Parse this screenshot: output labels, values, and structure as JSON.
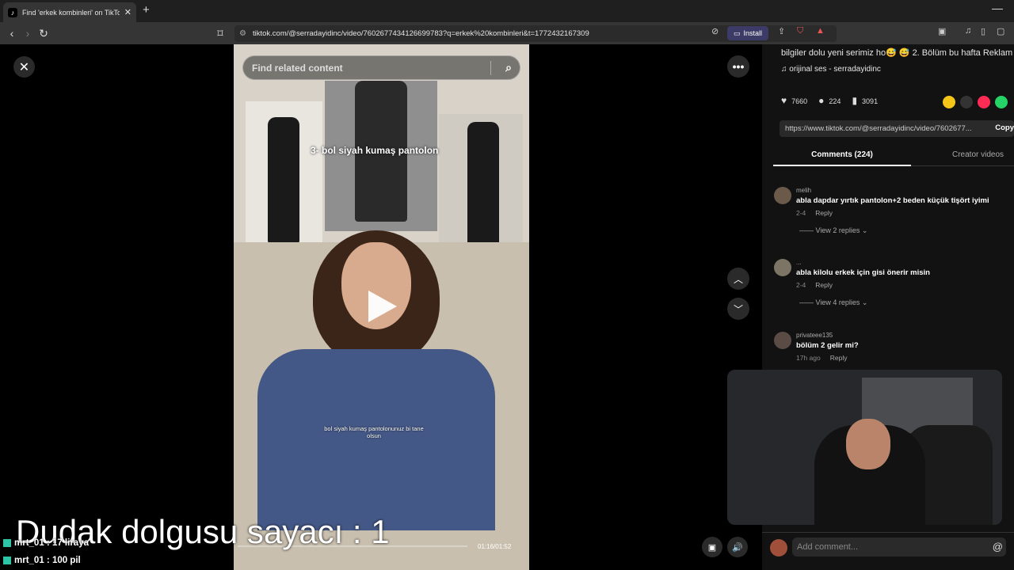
{
  "browser": {
    "tab_title": "Find 'erkek kombinleri' on TikTok",
    "tab_close": "✕",
    "new_tab": "+",
    "minimize": "—",
    "url": "tiktok.com/@serradayidinc/video/7602677434126699783?q=erkek%20kombinleri&t=1772432167309",
    "install_label": "Install"
  },
  "video": {
    "search_placeholder": "Find related content",
    "caption_top": "3- bol siyah kumaş pantolon",
    "caption_subtitle": "bol siyah kumaş pantolonunuz bi tane olsun",
    "timecode": "01:16/01:52"
  },
  "post": {
    "description": "bilgiler dolu yeni serimiz ho😅 😅  2. Bölüm bu hafta Reklam",
    "sound": "orijinal ses - serradayidinc",
    "likes": "7660",
    "comments": "224",
    "saves": "3091",
    "link": "https://www.tiktok.com/@serradayidinc/video/7602677...",
    "copy_label": "Copy",
    "tab_comments": "Comments (224)",
    "tab_creator": "Creator videos"
  },
  "comments": [
    {
      "user": "melih",
      "text": "abla dapdar yırtık pantolon+2 beden küçük tişört iyimi",
      "date": "2-4",
      "reply": "Reply",
      "more": "View 2 replies"
    },
    {
      "user": "...",
      "text": "abla kilolu erkek için gisi önerir misin",
      "date": "2-4",
      "reply": "Reply",
      "more": "View 4 replies"
    },
    {
      "user": "privateee135",
      "text": "bölüm 2 gelir mi?",
      "date": "17h ago",
      "reply": "Reply",
      "more": ""
    }
  ],
  "add_comment_placeholder": "Add comment...",
  "overlay": {
    "title": "Dudak dolgusu  sayacı : 1",
    "chat": [
      {
        "user": "mrt_01",
        "msg": ": 17 liraya"
      },
      {
        "user": "mrt_01",
        "msg": ": 100 pil"
      }
    ]
  },
  "colors": {
    "accent_install": "#3c3a66",
    "panel_bg": "#121212",
    "webcam_bg": "#2b2d30"
  }
}
